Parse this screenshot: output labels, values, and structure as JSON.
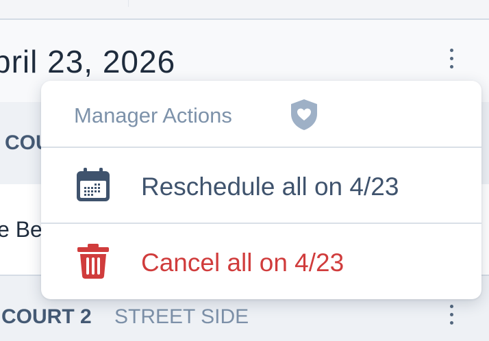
{
  "schedule": {
    "date_title": "pril 23, 2026"
  },
  "courts": [
    {
      "name": "COU",
      "session_name": "e Be"
    },
    {
      "name": "COURT 2",
      "subtitle": "STREET SIDE"
    }
  ],
  "menu": {
    "title": "Manager Actions",
    "title_icon": "shield-heart-icon",
    "items": [
      {
        "label": "Reschedule all on 4/23",
        "icon": "calendar-icon",
        "color": "#3f536d"
      },
      {
        "label": "Cancel all on 4/23",
        "icon": "trash-icon",
        "color": "#d03c3c"
      }
    ]
  },
  "colors": {
    "accent_danger": "#d03c3c",
    "text_primary": "#1f2c3d",
    "text_muted": "#7d92aa",
    "icon_slate": "#53677e"
  }
}
